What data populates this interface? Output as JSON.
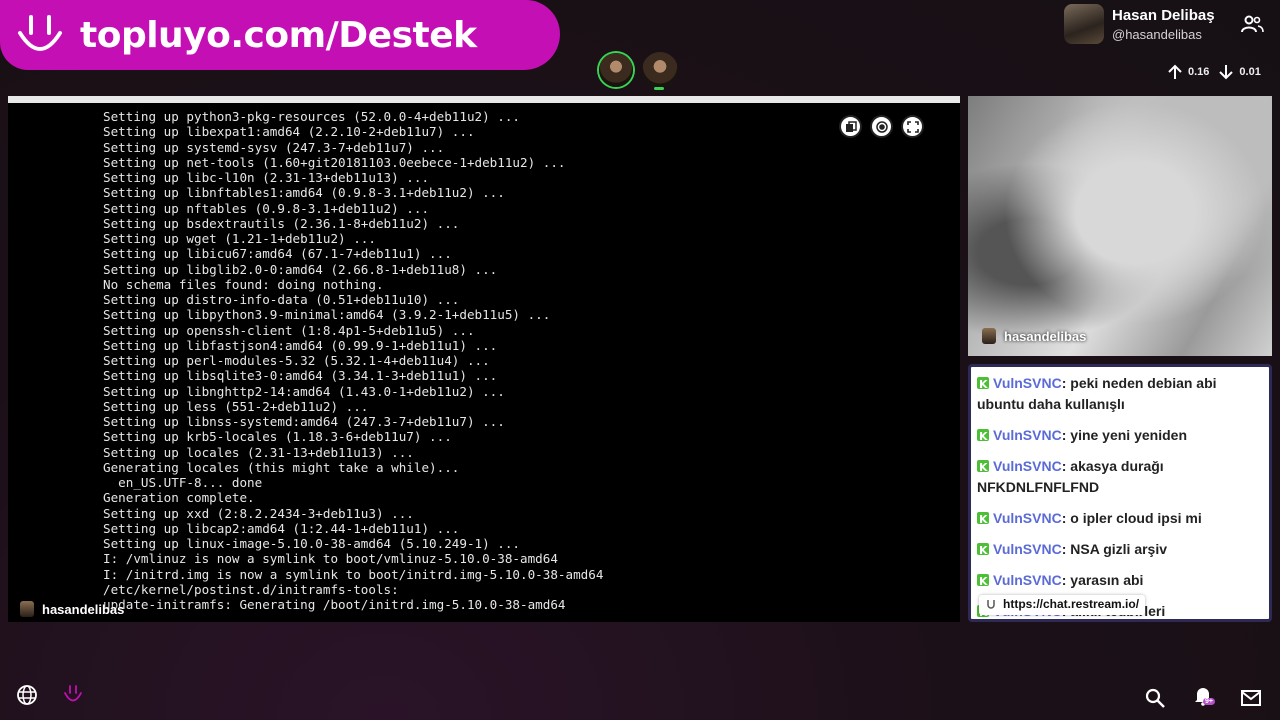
{
  "banner": {
    "text": "topluyo.com/Destek"
  },
  "user": {
    "name": "Hasan Delibaş",
    "handle": "@hasandelibas"
  },
  "stats": {
    "upload": "0.16",
    "download": "0.01"
  },
  "screen_share": {
    "owner": "hasandelibas",
    "terminal_lines": [
      "Setting up python3-pkg-resources (52.0.0-4+deb11u2) ...",
      "Setting up libexpat1:amd64 (2.2.10-2+deb11u7) ...",
      "Setting up systemd-sysv (247.3-7+deb11u7) ...",
      "Setting up net-tools (1.60+git20181103.0eebece-1+deb11u2) ...",
      "Setting up libc-l10n (2.31-13+deb11u13) ...",
      "Setting up libnftables1:amd64 (0.9.8-3.1+deb11u2) ...",
      "Setting up nftables (0.9.8-3.1+deb11u2) ...",
      "Setting up bsdextrautils (2.36.1-8+deb11u2) ...",
      "Setting up wget (1.21-1+deb11u2) ...",
      "Setting up libicu67:amd64 (67.1-7+deb11u1) ...",
      "Setting up libglib2.0-0:amd64 (2.66.8-1+deb11u8) ...",
      "No schema files found: doing nothing.",
      "Setting up distro-info-data (0.51+deb11u10) ...",
      "Setting up libpython3.9-minimal:amd64 (3.9.2-1+deb11u5) ...",
      "Setting up openssh-client (1:8.4p1-5+deb11u5) ...",
      "Setting up libfastjson4:amd64 (0.99.9-1+deb11u1) ...",
      "Setting up perl-modules-5.32 (5.32.1-4+deb11u4) ...",
      "Setting up libsqlite3-0:amd64 (3.34.1-3+deb11u1) ...",
      "Setting up libnghttp2-14:amd64 (1.43.0-1+deb11u2) ...",
      "Setting up less (551-2+deb11u2) ...",
      "Setting up libnss-systemd:amd64 (247.3-7+deb11u7) ...",
      "Setting up krb5-locales (1.18.3-6+deb11u7) ...",
      "Setting up locales (2.31-13+deb11u13) ...",
      "Generating locales (this might take a while)...",
      "  en_US.UTF-8... done",
      "Generation complete.",
      "Setting up xxd (2:8.2.2434-3+deb11u3) ...",
      "Setting up libcap2:amd64 (1:2.44-1+deb11u1) ...",
      "Setting up linux-image-5.10.0-38-amd64 (5.10.249-1) ...",
      "I: /vmlinuz is now a symlink to boot/vmlinuz-5.10.0-38-amd64",
      "I: /initrd.img is now a symlink to boot/initrd.img-5.10.0-38-amd64",
      "/etc/kernel/postinst.d/initramfs-tools:",
      "update-initramfs: Generating /boot/initrd.img-5.10.0-38-amd64"
    ]
  },
  "camera": {
    "owner": "hasandelibas"
  },
  "chat": {
    "messages": [
      {
        "author": "VulnSVNC",
        "text": "peki neden debian abi ubuntu daha kullanışlı"
      },
      {
        "author": "VulnSVNC",
        "text": "yine yeni yeniden"
      },
      {
        "author": "VulnSVNC",
        "text": "akasya durağı NFKDNLFNFLFND"
      },
      {
        "author": "VulnSVNC",
        "text": "o ipler cloud ipsi mi"
      },
      {
        "author": "VulnSVNC",
        "text": "NSA gizli arşiv"
      },
      {
        "author": "VulnSVNC",
        "text": "yarasın abi"
      },
      {
        "author": "VulnSVNC",
        "text": "alıklı tedbirleri"
      }
    ],
    "tooltip_url": "https://chat.restream.io/"
  },
  "notifications": {
    "badge": "9+"
  },
  "colors": {
    "brand": "#c40fb4",
    "chat_author": "#5b6bd6",
    "active_ring": "#39d353"
  }
}
